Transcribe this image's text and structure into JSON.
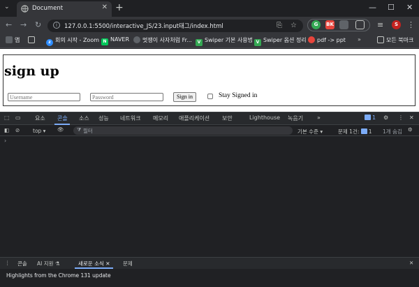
{
  "browser": {
    "tab_title": "Document",
    "url": "127.0.0.1:5500/interactive_JS/23.input태그/index.html",
    "profile_initial": "S",
    "bookmarks": [
      "앱",
      "회의 시작 - Zoom",
      "NAVER",
      "멋쟁이 사자처럼 Fr...",
      "Swiper 기본 사용법",
      "Swiper 옵션 정리",
      "pdf -> ppt",
      "모든 북마크"
    ],
    "ext_labels": [
      "G",
      "BK",
      "",
      ""
    ]
  },
  "page": {
    "heading": "sign up",
    "username_placeholder": "Username",
    "password_placeholder": "Password",
    "signin_label": "Sign in",
    "stay_signed_label": "Stay Signed in"
  },
  "devtools": {
    "tabs": [
      "요소",
      "콘솔",
      "소스",
      "성능",
      "네트워크",
      "메모리",
      "애플리케이션",
      "보안",
      "Lighthouse",
      "녹음기"
    ],
    "active_tab": "콘솔",
    "issue_count": "1",
    "context": "top",
    "filter_placeholder": "필터",
    "level": "기본 수준",
    "issues": "문제 1건:",
    "issues_count": "1",
    "hidden": "1개 숨김",
    "drawer_tabs": [
      "콘솔",
      "AI 지원",
      "새로운 소식",
      "문제"
    ],
    "whats_new": "Highlights from the Chrome 131 update"
  },
  "colors": {
    "accent": "#7cacf8",
    "chrome_bg": "#35363a",
    "devtools_bg": "#202124"
  }
}
